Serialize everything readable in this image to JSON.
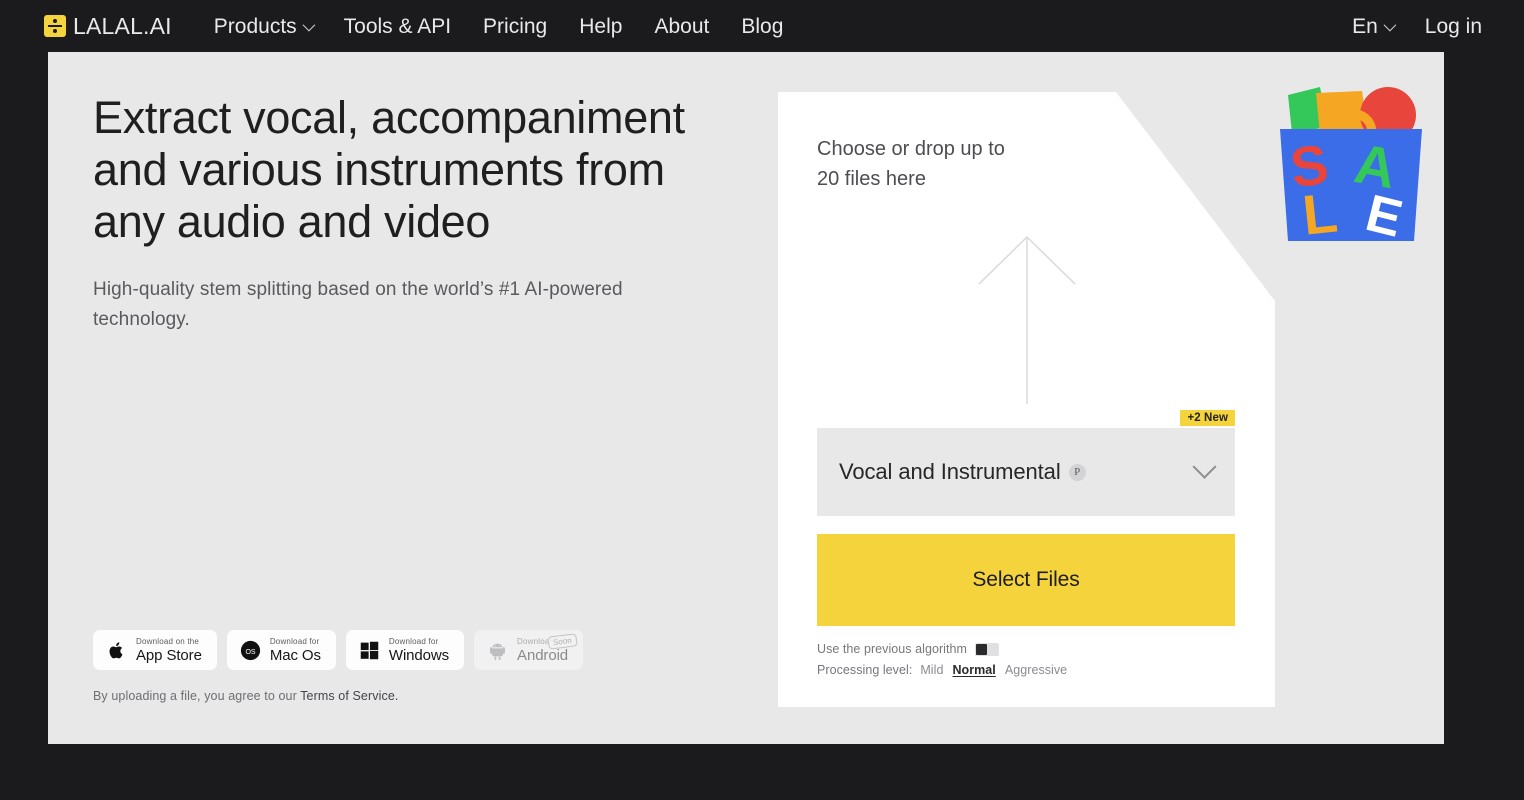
{
  "nav": {
    "brand": "LALAL.AI",
    "brand_icon": "division-logo-icon",
    "links": [
      {
        "label": "Products",
        "has_caret": true
      },
      {
        "label": "Tools & API",
        "has_caret": false
      },
      {
        "label": "Pricing",
        "has_caret": false
      },
      {
        "label": "Help",
        "has_caret": false
      },
      {
        "label": "About",
        "has_caret": false
      },
      {
        "label": "Blog",
        "has_caret": false
      }
    ],
    "language": "En",
    "login": "Log in"
  },
  "hero": {
    "headline": "Extract vocal, accompaniment and various instruments from any audio and video",
    "subhead": "High-quality stem splitting based on the world’s #1 AI-powered technology.",
    "legal_prefix": "By uploading a file, you agree to our ",
    "legal_link": "Terms of Service.",
    "stores": [
      {
        "small": "Download on the",
        "big": "App Store",
        "icon": "apple-icon",
        "disabled": false,
        "tag": ""
      },
      {
        "small": "Download for",
        "big": "Mac Os",
        "icon": "macos-icon",
        "disabled": false,
        "tag": ""
      },
      {
        "small": "Download for",
        "big": "Windows",
        "icon": "windows-icon",
        "disabled": false,
        "tag": ""
      },
      {
        "small": "Download for",
        "big": "Android",
        "icon": "android-icon",
        "disabled": true,
        "tag": "Soon"
      }
    ]
  },
  "upload": {
    "drop_title": "Choose or drop up to 20 files here",
    "arrow_icon": "upload-arrow-icon",
    "selector_value": "Vocal and Instrumental",
    "selector_badge": "P",
    "new_tag": "+2 New",
    "cta_label": "Select Files",
    "previous_algorithm_label": "Use the previous algorithm",
    "previous_algorithm_state": "off",
    "processing_label": "Processing level:",
    "processing_levels": [
      {
        "label": "Mild",
        "selected": false
      },
      {
        "label": "Normal",
        "selected": true
      },
      {
        "label": "Aggressive",
        "selected": false
      }
    ]
  },
  "promo": {
    "graphic": "sale-shopping-bag-graphic",
    "letters": [
      "S",
      "A",
      "L",
      "E"
    ],
    "colors": {
      "bag": "#3b6de8",
      "s": "#e8453c",
      "a": "#34a853",
      "l": "#f5a623",
      "e": "#ffffff",
      "shape_green": "#34c759",
      "shape_orange": "#f5a623",
      "shape_red": "#e8453c"
    }
  },
  "theme": {
    "page_background": "#1b1b1d",
    "hero_background": "#e8e8e9",
    "card_background": "#ffffff",
    "accent": "#f5d33c",
    "text_dark": "#1f1f20",
    "text_muted": "#6e6e73"
  }
}
